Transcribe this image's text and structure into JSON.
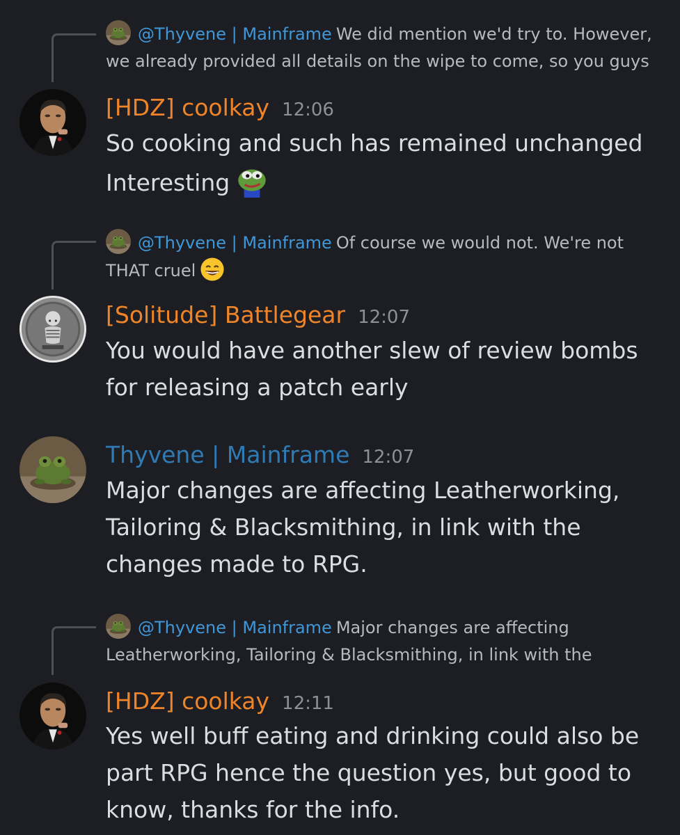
{
  "messages": [
    {
      "reply": {
        "mention": "@Thyvene | Mainframe",
        "line1": "We did mention we'd try to. However,",
        "line2": "we already provided all details on the wipe to come, so you guys"
      },
      "author": "[HDZ] coolkay",
      "time": "12:06",
      "lines": [
        "So cooking and such has remained unchanged",
        "Interesting"
      ],
      "emoji": "pepe-frog-emoji"
    },
    {
      "reply": {
        "mention": "@Thyvene | Mainframe",
        "line1": "Of course we would not. We're not",
        "line2": "THAT cruel"
      },
      "reply_emoji": "grinning-face-emoji",
      "author": "[Solitude] Battlegear",
      "time": "12:07",
      "lines": [
        "You would have another slew of review bombs",
        "for releasing a patch early"
      ]
    },
    {
      "author": "Thyvene | Mainframe",
      "time": "12:07",
      "lines": [
        "Major changes are affecting Leatherworking,",
        "Tailoring & Blacksmithing, in link with the",
        "changes made to RPG."
      ]
    },
    {
      "reply": {
        "mention": "@Thyvene | Mainframe",
        "line1": "Major changes are affecting",
        "line2": "Leatherworking, Tailoring & Blacksmithing, in link with the"
      },
      "author": "[HDZ] coolkay",
      "time": "12:11",
      "lines": [
        "Yes well buff eating and drinking could also be",
        "part RPG hence the question yes, but good to",
        "know, thanks for the info."
      ]
    }
  ],
  "colors": {
    "background": "#1d1e23",
    "role_orange": "#ef8428",
    "role_blue": "#2f7bb5",
    "mention": "#3f97d8",
    "timestamp": "#8e9099"
  }
}
